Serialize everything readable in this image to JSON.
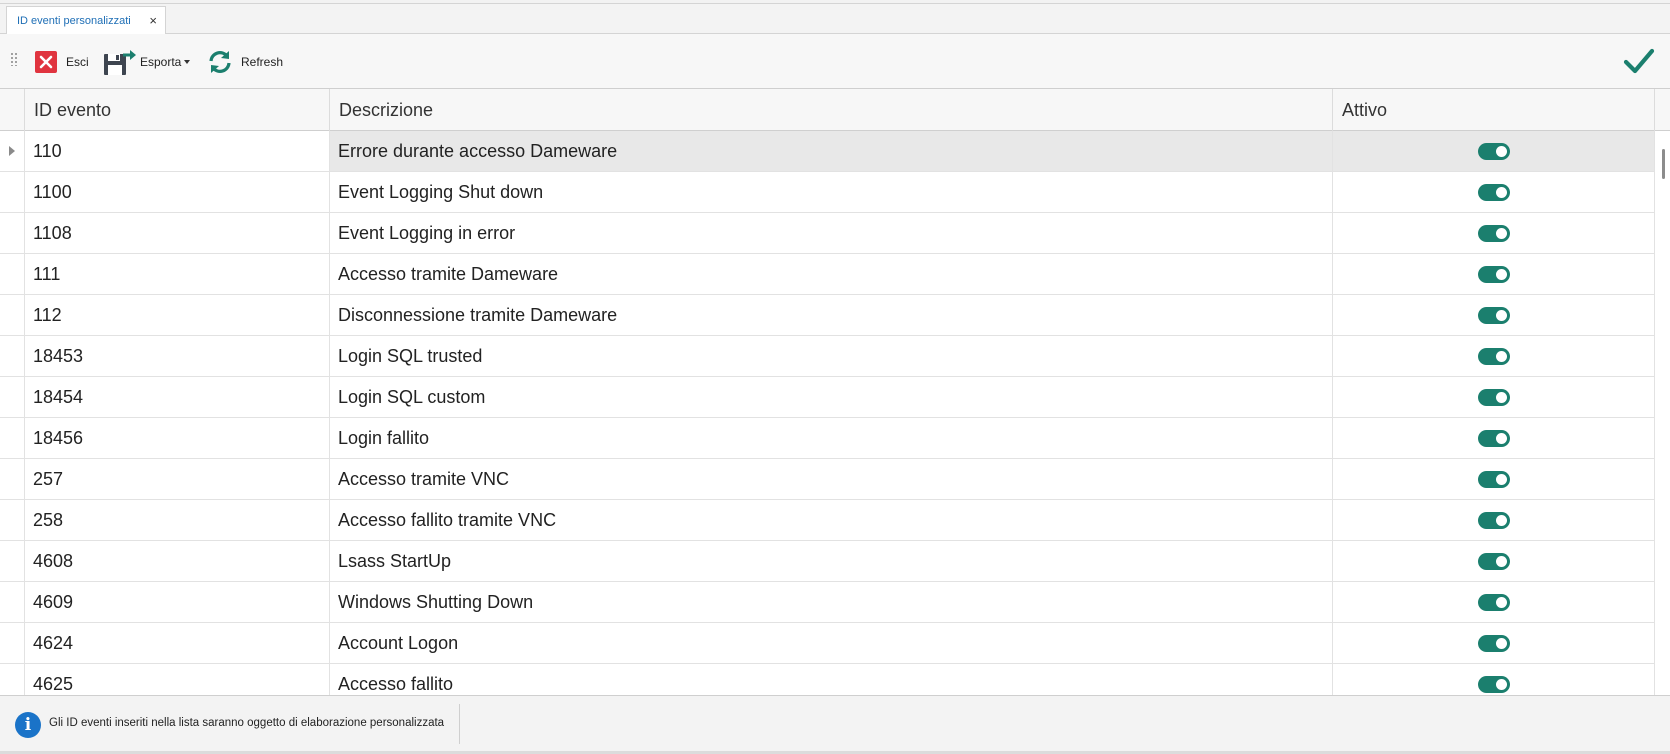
{
  "tab": {
    "label": "ID eventi personalizzati",
    "close": "×"
  },
  "toolbar": {
    "exit_label": "Esci",
    "export_label": "Esporta",
    "refresh_label": "Refresh"
  },
  "colors": {
    "accent": "#1b7f6e",
    "tab_text": "#1f6fb6",
    "exit_red": "#e0343f",
    "info_blue": "#1a73c8"
  },
  "grid": {
    "columns": {
      "id": "ID evento",
      "description": "Descrizione",
      "active": "Attivo"
    },
    "rows": [
      {
        "id": "110",
        "description": "Errore durante accesso Dameware",
        "active": true,
        "selected": true
      },
      {
        "id": "1100",
        "description": "Event Logging Shut down",
        "active": true
      },
      {
        "id": "1108",
        "description": "Event Logging in error",
        "active": true
      },
      {
        "id": "111",
        "description": "Accesso tramite Dameware",
        "active": true
      },
      {
        "id": "112",
        "description": "Disconnessione tramite Dameware",
        "active": true
      },
      {
        "id": "18453",
        "description": "Login SQL trusted",
        "active": true
      },
      {
        "id": "18454",
        "description": "Login SQL custom",
        "active": true
      },
      {
        "id": "18456",
        "description": "Login fallito",
        "active": true
      },
      {
        "id": "257",
        "description": "Accesso tramite VNC",
        "active": true
      },
      {
        "id": "258",
        "description": "Accesso fallito tramite VNC",
        "active": true
      },
      {
        "id": "4608",
        "description": "Lsass StartUp",
        "active": true
      },
      {
        "id": "4609",
        "description": "Windows Shutting Down",
        "active": true
      },
      {
        "id": "4624",
        "description": "Account Logon",
        "active": true
      },
      {
        "id": "4625",
        "description": "Accesso fallito",
        "active": true
      }
    ]
  },
  "status": {
    "icon": "info-icon",
    "message": "Gli ID eventi inseriti nella lista saranno oggetto di elaborazione personalizzata"
  }
}
